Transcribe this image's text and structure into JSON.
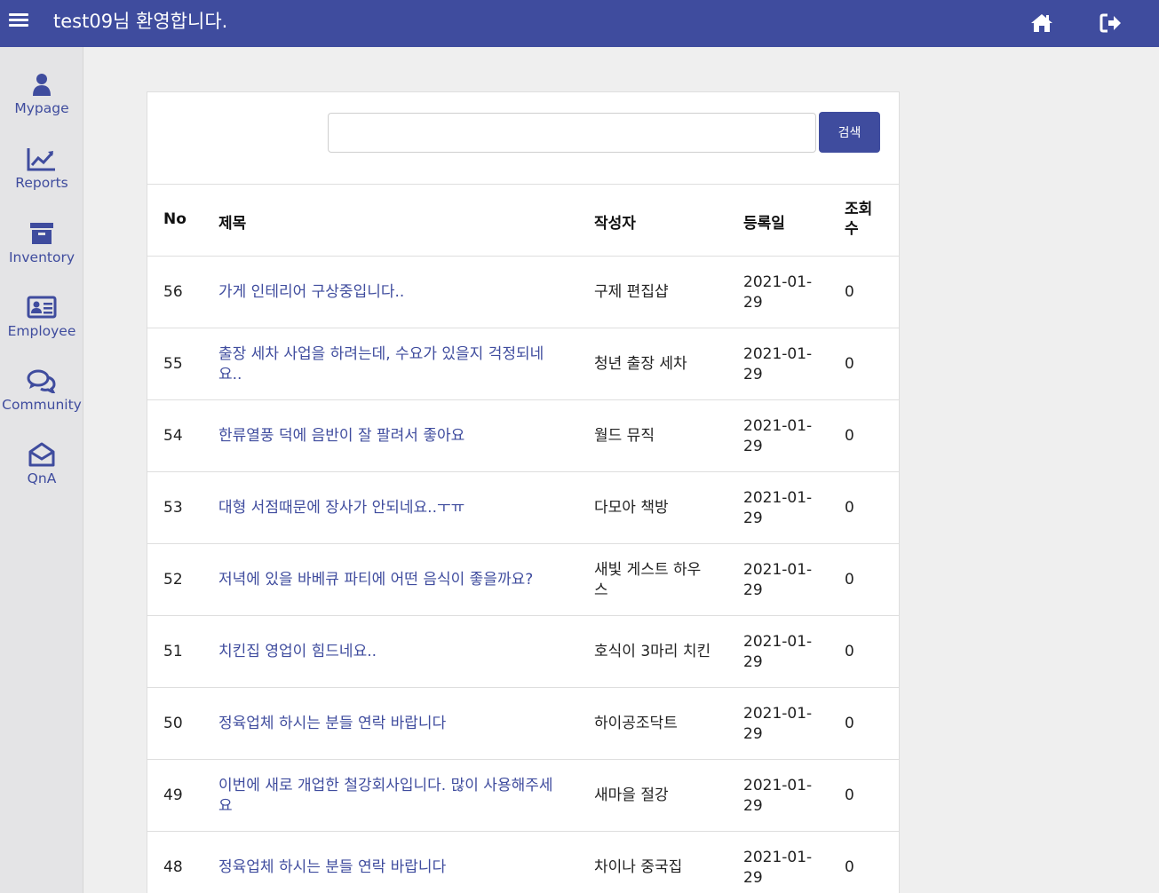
{
  "header": {
    "welcome": "test09님 환영합니다.",
    "menu_icon": "hamburger-menu-icon",
    "home_icon": "home-icon",
    "logout_icon": "sign-out-icon"
  },
  "sidebar": {
    "items": [
      {
        "label": "Mypage",
        "icon": "user-icon"
      },
      {
        "label": "Reports",
        "icon": "line-chart-icon"
      },
      {
        "label": "Inventory",
        "icon": "archive-box-icon"
      },
      {
        "label": "Employee",
        "icon": "id-card-icon"
      },
      {
        "label": "Community",
        "icon": "chat-bubbles-icon"
      },
      {
        "label": "QnA",
        "icon": "envelope-open-icon"
      }
    ]
  },
  "search": {
    "value": "",
    "button_label": "검색"
  },
  "table": {
    "headers": {
      "no": "No",
      "title": "제목",
      "author": "작성자",
      "date": "등록일",
      "views": "조회수"
    },
    "rows": [
      {
        "no": "56",
        "title": "가게 인테리어 구상중입니다..",
        "author": "구제 편집샵",
        "date": "2021-01-29",
        "views": "0"
      },
      {
        "no": "55",
        "title": "출장 세차 사업을 하려는데, 수요가 있을지 걱정되네요..",
        "author": "청년 출장 세차",
        "date": "2021-01-29",
        "views": "0"
      },
      {
        "no": "54",
        "title": "한류열풍 덕에 음반이 잘 팔려서 좋아요",
        "author": "월드 뮤직",
        "date": "2021-01-29",
        "views": "0"
      },
      {
        "no": "53",
        "title": "대형 서점때문에 장사가 안되네요..ㅜㅠ",
        "author": "다모아 책방",
        "date": "2021-01-29",
        "views": "0"
      },
      {
        "no": "52",
        "title": "저녁에 있을 바베큐 파티에 어떤 음식이 좋을까요?",
        "author": "새빛 게스트 하우스",
        "date": "2021-01-29",
        "views": "0"
      },
      {
        "no": "51",
        "title": "치킨집 영업이 힘드네요..",
        "author": "호식이 3마리 치킨",
        "date": "2021-01-29",
        "views": "0"
      },
      {
        "no": "50",
        "title": "정육업체 하시는 분들 연락 바랍니다",
        "author": "하이공조닥트",
        "date": "2021-01-29",
        "views": "0"
      },
      {
        "no": "49",
        "title": "이번에 새로 개업한 철강회사입니다. 많이 사용해주세요",
        "author": "새마을 절강",
        "date": "2021-01-29",
        "views": "0"
      },
      {
        "no": "48",
        "title": "정육업체 하시는 분들 연락 바랍니다",
        "author": "차이나 중국집",
        "date": "2021-01-29",
        "views": "0"
      }
    ]
  }
}
